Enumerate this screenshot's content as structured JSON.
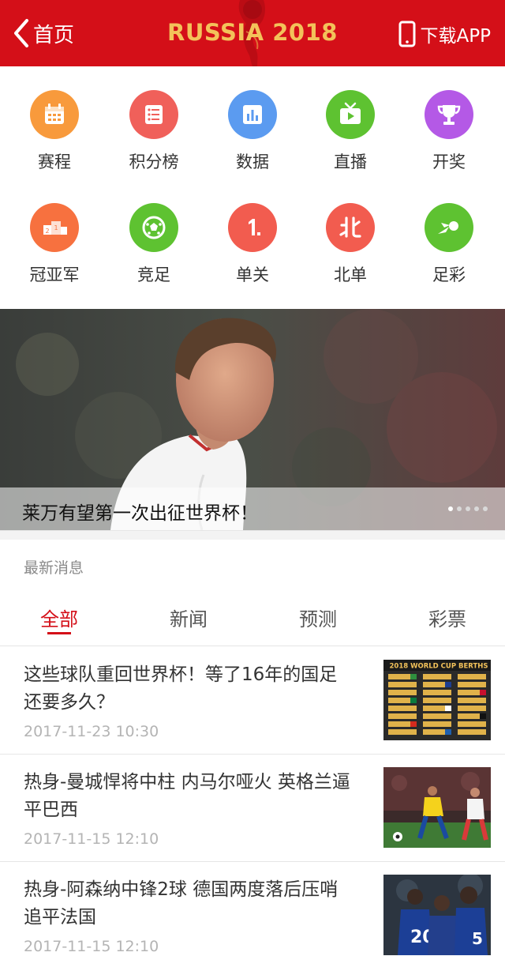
{
  "header": {
    "back_label": "首页",
    "title": "RUSSIA 2018",
    "download_label": "下载APP",
    "background": "#d40f18",
    "title_color": "#f3c25a"
  },
  "grid": {
    "items": [
      {
        "label": "赛程",
        "icon": "calendar-icon",
        "color": "#f89a3c"
      },
      {
        "label": "积分榜",
        "icon": "list-icon",
        "color": "#f0605a"
      },
      {
        "label": "数据",
        "icon": "bar-chart-icon",
        "color": "#5b9bf0"
      },
      {
        "label": "直播",
        "icon": "tv-icon",
        "color": "#5ec231"
      },
      {
        "label": "开奖",
        "icon": "trophy-icon",
        "color": "#b459e6"
      },
      {
        "label": "冠亚军",
        "icon": "podium-icon",
        "color": "#f7713f"
      },
      {
        "label": "竞足",
        "icon": "football-icon",
        "color": "#5ec231"
      },
      {
        "label": "单关",
        "icon": "number-one-icon",
        "color": "#f25c4f"
      },
      {
        "label": "北单",
        "icon": "bei-icon",
        "color": "#f25c4f"
      },
      {
        "label": "足彩",
        "icon": "shooting-ball-icon",
        "color": "#5ec231"
      }
    ]
  },
  "banner": {
    "caption": "莱万有望第一次出征世界杯！",
    "slide_count": 5,
    "active_slide": 1
  },
  "news": {
    "section_title": "最新消息",
    "tabs": [
      "全部",
      "新闻",
      "预测",
      "彩票"
    ],
    "active_tab": "全部",
    "items": [
      {
        "title": "这些球队重回世界杯！等了16年的国足还要多久？",
        "time": "2017-11-23   10:30",
        "thumb": "world-cup-berths-thumbnail",
        "thumb_text": "2018 WORLD CUP BERTHS"
      },
      {
        "title": "热身-曼城悍将中柱 内马尔哑火 英格兰逼平巴西",
        "time": "2017-11-15   12:10",
        "thumb": "match-photo-thumbnail"
      },
      {
        "title": "热身-阿森纳中锋2球 德国两度落后压哨追平法国",
        "time": "2017-11-15   12:10",
        "thumb": "players-photo-thumbnail"
      }
    ]
  }
}
